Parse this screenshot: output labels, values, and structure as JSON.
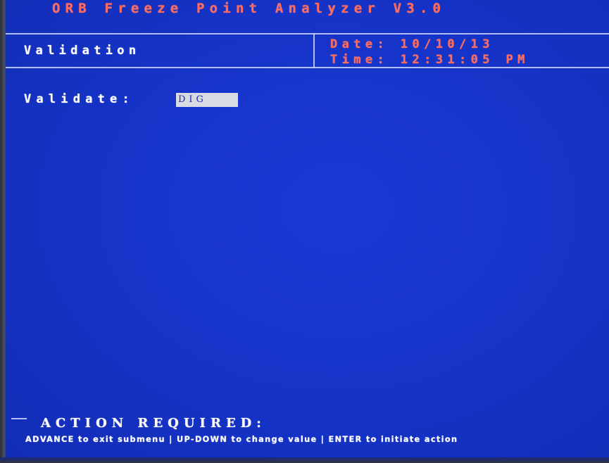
{
  "header": {
    "app_title": "ORB Freeze Point Analyzer V3.0",
    "screen_title": "Validation",
    "date_line": "Date: 10/10/13",
    "time_line": "Time: 12:31:05 PM"
  },
  "main": {
    "field_label": "Validate:",
    "field_value": "DIG"
  },
  "footer": {
    "action_title": "ACTION REQUIRED:",
    "hint": "ADVANCE to exit submenu | UP-DOWN to change value | ENTER to initiate action"
  },
  "colors": {
    "background": "#1532c8",
    "title_text": "#ff6a5c",
    "body_text": "#ffffff",
    "rule_lines": "#cfd7ff",
    "selection_bg": "#d9dbe2"
  }
}
